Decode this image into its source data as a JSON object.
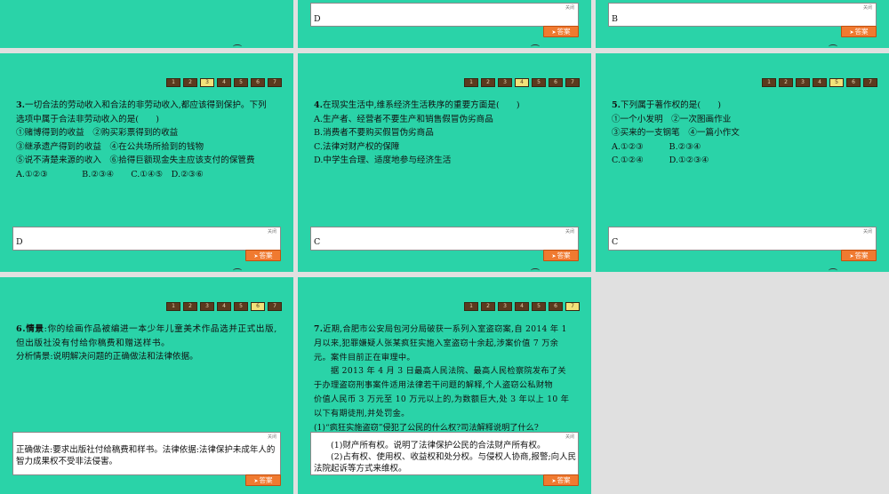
{
  "nav_numbers": [
    "1",
    "2",
    "3",
    "4",
    "5",
    "6",
    "7"
  ],
  "close_label": "关闭",
  "answer_button_label": "答案",
  "top_row": {
    "slide2_answer": "D",
    "slide3_answer": "B"
  },
  "q3": {
    "current": 3,
    "number": "3.",
    "lines": [
      "一切合法的劳动收入和合法的非劳动收入,都应该得到保护。下列",
      "选项中属于合法非劳动收入的是(　　)",
      "①赌博得到的收益　②购买彩票得到的收益",
      "③继承遗产得到的收益　④在公共场所拾到的钱物",
      "⑤说不清楚来源的收入　⑥拾得巨额现金失主应该支付的保管费",
      "A.①②③　　　　B.②③④　　C.①④⑤　D.②③⑥"
    ],
    "answer": "D"
  },
  "q4": {
    "current": 4,
    "number": "4.",
    "lines": [
      "在现实生活中,维系经济生活秩序的重要方面是(　　)",
      "A.生产者、经营者不要生产和销售假冒伪劣商品",
      "B.消费者不要购买假冒伪劣商品",
      "C.法律对财产权的保障",
      "D.中学生合理、适度地参与经济生活"
    ],
    "answer": "C"
  },
  "q5": {
    "current": 5,
    "number": "5.",
    "lines": [
      "下列属于著作权的是(　　)",
      "①一个小发明　②一次图画作业",
      "③买来的一支钢笔　④一篇小作文",
      "A.①②③　　　B.②③④",
      "C.①②④　　　D.①②③④"
    ],
    "answer": "C"
  },
  "q6": {
    "current": 6,
    "number": "6.",
    "label": "情景",
    "lines": [
      ":你的绘画作品被编进一本少年儿童美术作品选并正式出版,",
      "但出版社没有付给你稿费和赠送样书。",
      "分析情景:说明解决问题的正确做法和法律依据。"
    ],
    "answer_lines": [
      "正确做法:要求出版社付给稿费和样书。法律依据:法律保护未成年人的",
      "智力成果权不受非法侵害。"
    ]
  },
  "q7": {
    "current": 7,
    "number": "7.",
    "lines": [
      "近期,合肥市公安局包河分局破获一系列入室盗窃案,自 2014 年 1",
      "月以来,犯罪嫌疑人张某疯狂实施入室盗窃十余起,涉案价值 7 万余",
      "元。案件目前正在审理中。",
      "　　据 2013 年 4 月 3 日最高人民法院、最高人民检察院发布了关",
      "于办理盗窃刑事案件适用法律若干问题的解释,个人盗窃公私财物",
      "价值人民币 3 万元至 10 万元以上的,为数额巨大,处 3 年以上 10 年",
      "以下有期徒刑,并处罚金。",
      "(1)“疯狂实施盗窃”侵犯了公民的什么权?司法解释说明了什么?"
    ],
    "answer_lines": [
      "　　(1)财产所有权。说明了法律保护公民的合法财产所有权。",
      "　　(2)占有权、使用权、收益权和处分权。与侵权人协商,报警;向人民",
      "法院起诉等方式来维权。"
    ]
  }
}
